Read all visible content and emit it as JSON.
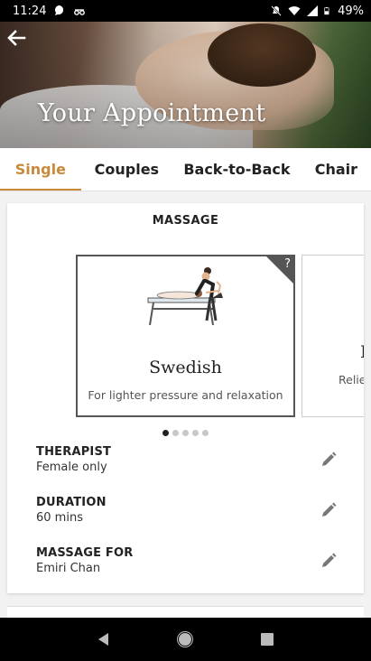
{
  "status_bar": {
    "time": "11:24",
    "battery": "49%",
    "icons": [
      "chat-notification-icon",
      "vr-icon",
      "mute-icon",
      "wifi-icon",
      "signal-icon",
      "battery-icon"
    ]
  },
  "header": {
    "title": "Your Appointment",
    "back_icon": "arrow-left-icon"
  },
  "tabs": [
    {
      "label": "Single",
      "active": true
    },
    {
      "label": "Couples",
      "active": false
    },
    {
      "label": "Back-to-Back",
      "active": false
    },
    {
      "label": "Chair",
      "active": false
    }
  ],
  "massage": {
    "section_title": "MASSAGE",
    "options": [
      {
        "name": "Swedish",
        "description": "For lighter pressure and relaxation",
        "selected": true,
        "info_icon": "?"
      },
      {
        "name": "D",
        "description": "Reliev",
        "selected": false
      }
    ],
    "pagination": {
      "count": 5,
      "current": 1
    }
  },
  "details": [
    {
      "label": "THERAPIST",
      "value": "Female only"
    },
    {
      "label": "DURATION",
      "value": "60 mins"
    },
    {
      "label": "MASSAGE FOR",
      "value": "Emiri Chan"
    }
  ],
  "colors": {
    "accent": "#c9893a",
    "text": "#222222",
    "border": "#555555"
  }
}
